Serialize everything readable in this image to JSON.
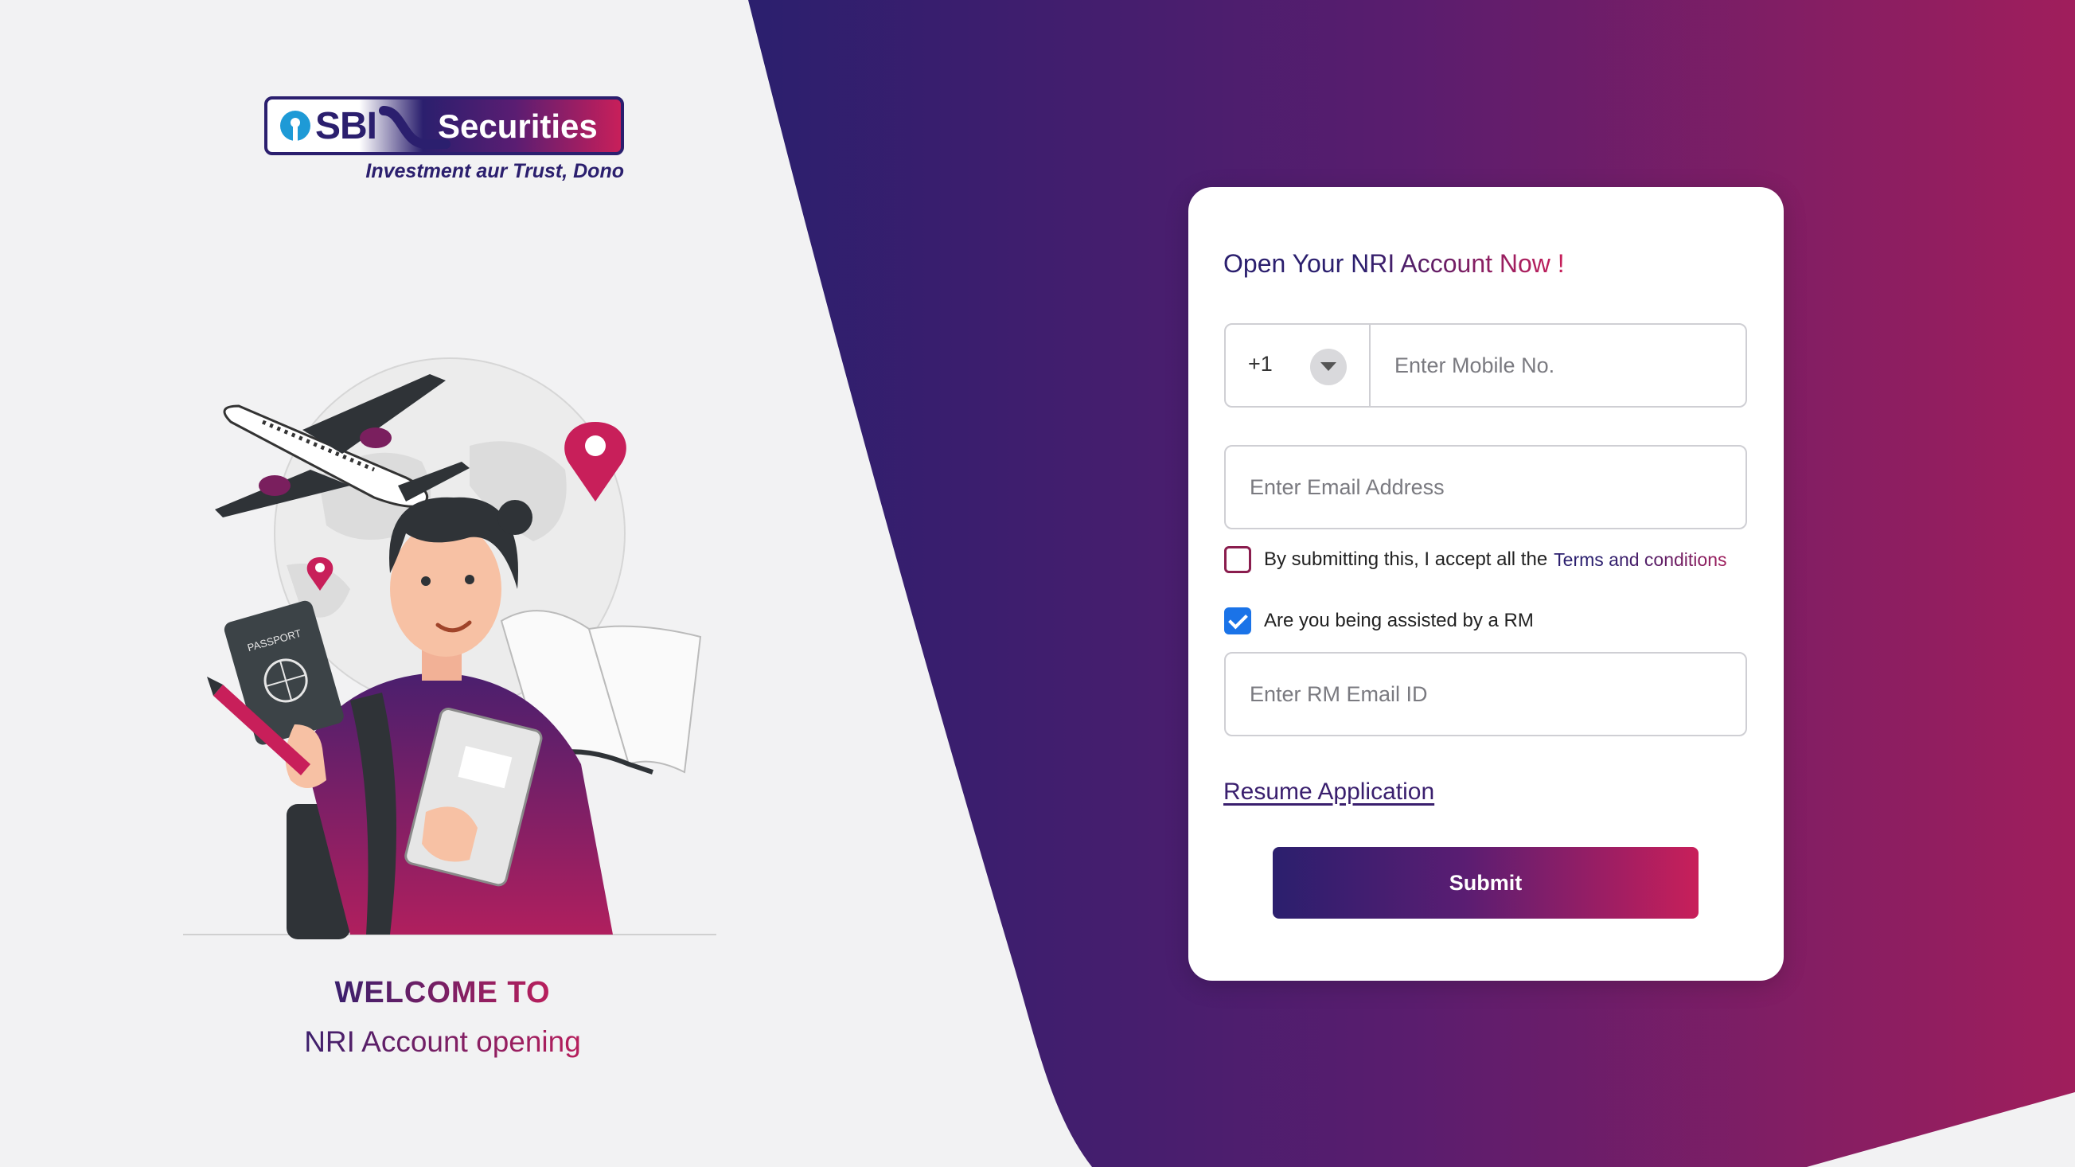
{
  "brand": {
    "logo_sbi": "SBI",
    "logo_securities": "Securities",
    "tagline": "Investment aur Trust, Dono"
  },
  "welcome": {
    "title": "WELCOME TO",
    "subtitle": "NRI Account opening"
  },
  "illustration": {
    "passport_label": "PASSPORT"
  },
  "form": {
    "title": "Open Your NRI Account Now !",
    "country_code": "+1",
    "mobile_placeholder": "Enter Mobile No.",
    "email_placeholder": "Enter Email Address",
    "terms_text": "By submitting this, I accept all the",
    "terms_link": "Terms and conditions",
    "terms_checked": false,
    "rm_text": "Are you being assisted by a RM",
    "rm_checked": true,
    "rm_email_placeholder": "Enter RM Email ID",
    "resume_link": "Resume Application",
    "submit_label": "Submit"
  },
  "colors": {
    "brand_navy": "#2b1f6e",
    "brand_magenta": "#c81f5a",
    "checkbox_blue": "#1a73e8",
    "page_bg": "#f2f2f3"
  }
}
